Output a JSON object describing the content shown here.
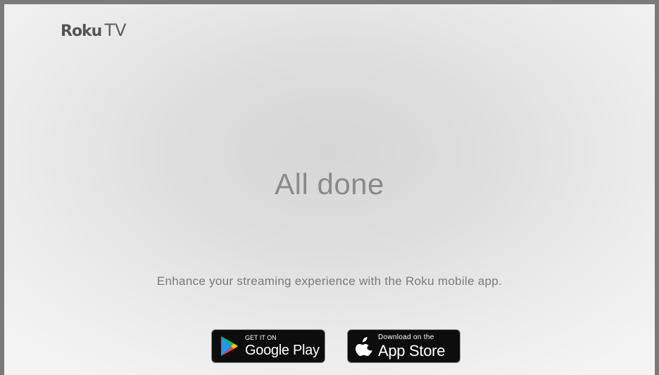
{
  "header": {
    "logo_roku": "Roku",
    "logo_tv": "TV"
  },
  "main": {
    "title": "All done",
    "subtitle": "Enhance your streaming experience with the Roku mobile app."
  },
  "badges": {
    "google": {
      "small": "GET IT ON",
      "big": "Google Play",
      "icon": "google-play-icon"
    },
    "apple": {
      "small": "Download on the",
      "big": "App Store",
      "icon": "apple-icon"
    }
  },
  "colors": {
    "frame": "#7a7a7a",
    "badge_bg": "#0d0d0d",
    "text_gray": "#8a8a8a"
  }
}
